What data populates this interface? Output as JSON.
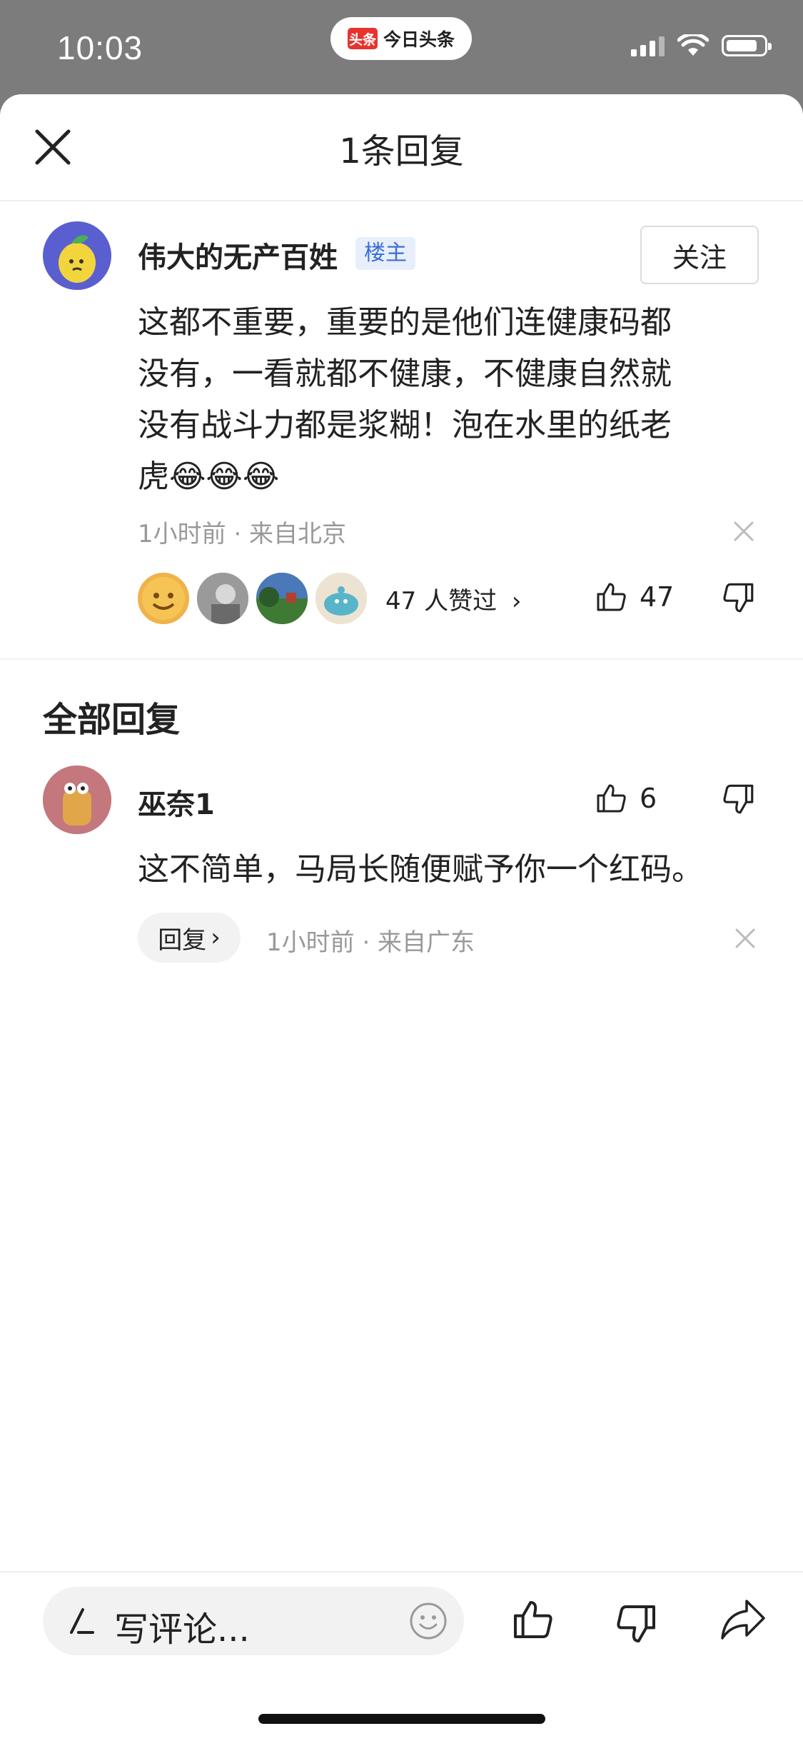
{
  "status_bar": {
    "time": "10:03",
    "app_logo_text": "头条",
    "app_name": "今日头条"
  },
  "header": {
    "title": "1条回复"
  },
  "main_comment": {
    "username": "伟大的无产百姓",
    "badge": "楼主",
    "follow_label": "关注",
    "text_lines": [
      "这都不重要，重要的是他们连健康码都",
      "没有，一看就都不健康，不健康自然就",
      "没有战斗力都是浆糊！泡在水里的纸老",
      "虎😂😂😂"
    ],
    "meta": "1小时前 · 来自北京",
    "likers_text": "47 人赞过",
    "like_count": "47"
  },
  "replies_section": {
    "title": "全部回复",
    "items": [
      {
        "username": "巫奈1",
        "like_count": "6",
        "text": "这不简单，马局长随便赋予你一个红码。",
        "reply_label": "回复",
        "meta": "1小时前 · 来自广东"
      }
    ]
  },
  "bottom_bar": {
    "placeholder": "写评论..."
  },
  "colors": {
    "status_bar_bg": "#7c7c7c",
    "badge_text": "#3d6ed8",
    "badge_bg": "#e8effc",
    "brand_red": "#e8322e"
  }
}
